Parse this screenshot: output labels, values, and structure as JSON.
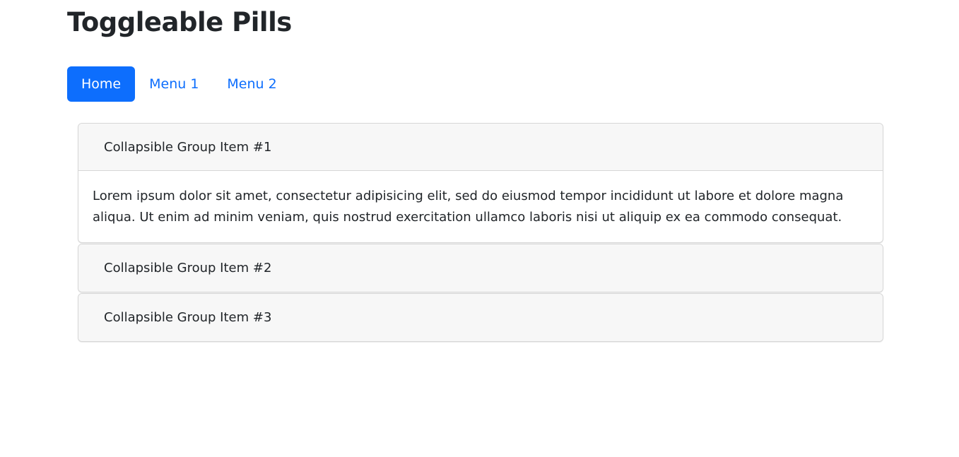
{
  "page": {
    "title": "Toggleable Pills"
  },
  "pills": [
    {
      "label": "Home",
      "active": true
    },
    {
      "label": "Menu 1",
      "active": false
    },
    {
      "label": "Menu 2",
      "active": false
    }
  ],
  "accordion": {
    "items": [
      {
        "title": "Collapsible Group Item #1",
        "expanded": true,
        "body": "Lorem ipsum dolor sit amet, consectetur adipisicing elit, sed do eiusmod tempor incididunt ut labore et dolore magna aliqua. Ut enim ad minim veniam, quis nostrud exercitation ullamco laboris nisi ut aliquip ex ea commodo consequat."
      },
      {
        "title": "Collapsible Group Item #2",
        "expanded": false
      },
      {
        "title": "Collapsible Group Item #3",
        "expanded": false
      }
    ]
  },
  "colors": {
    "accent": "#0d6efd",
    "header_bg": "#f7f7f7",
    "border": "#d6d6d6",
    "text": "#212529"
  }
}
